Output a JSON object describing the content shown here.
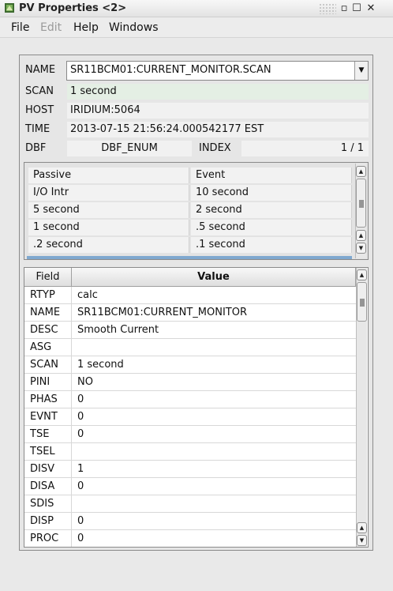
{
  "window": {
    "title": "PV Properties <2>"
  },
  "menu": {
    "file": "File",
    "edit": "Edit",
    "help": "Help",
    "windows": "Windows"
  },
  "props": {
    "name_label": "NAME",
    "name_value": "SR11BCM01:CURRENT_MONITOR.SCAN",
    "scan_label": "SCAN",
    "scan_value": "1 second",
    "host_label": "HOST",
    "host_value": "IRIDIUM:5064",
    "time_label": "TIME",
    "time_value": "2013-07-15 21:56:24.000542177  EST",
    "dbf_label": "DBF",
    "dbf_value": "DBF_ENUM",
    "index_label": "INDEX",
    "index_value": "1 / 1"
  },
  "scan_options": [
    [
      "Passive",
      "Event"
    ],
    [
      "I/O Intr",
      "10 second"
    ],
    [
      "5 second",
      "2 second"
    ],
    [
      "1 second",
      ".5 second"
    ],
    [
      ".2 second",
      ".1 second"
    ]
  ],
  "table": {
    "headers": {
      "field": "Field",
      "value": "Value"
    },
    "rows": [
      [
        "RTYP",
        "calc"
      ],
      [
        "NAME",
        "SR11BCM01:CURRENT_MONITOR"
      ],
      [
        "DESC",
        "Smooth Current"
      ],
      [
        "ASG",
        ""
      ],
      [
        "SCAN",
        "1 second"
      ],
      [
        "PINI",
        "NO"
      ],
      [
        "PHAS",
        "0"
      ],
      [
        "EVNT",
        "0"
      ],
      [
        "TSE",
        "0"
      ],
      [
        "TSEL",
        ""
      ],
      [
        "DISV",
        "1"
      ],
      [
        "DISA",
        "0"
      ],
      [
        "SDIS",
        ""
      ],
      [
        "DISP",
        "0"
      ],
      [
        "PROC",
        "0"
      ]
    ]
  },
  "colors": {
    "selection_bar": "#7fa8cf",
    "scan_row_bg": "#e4efe4"
  }
}
